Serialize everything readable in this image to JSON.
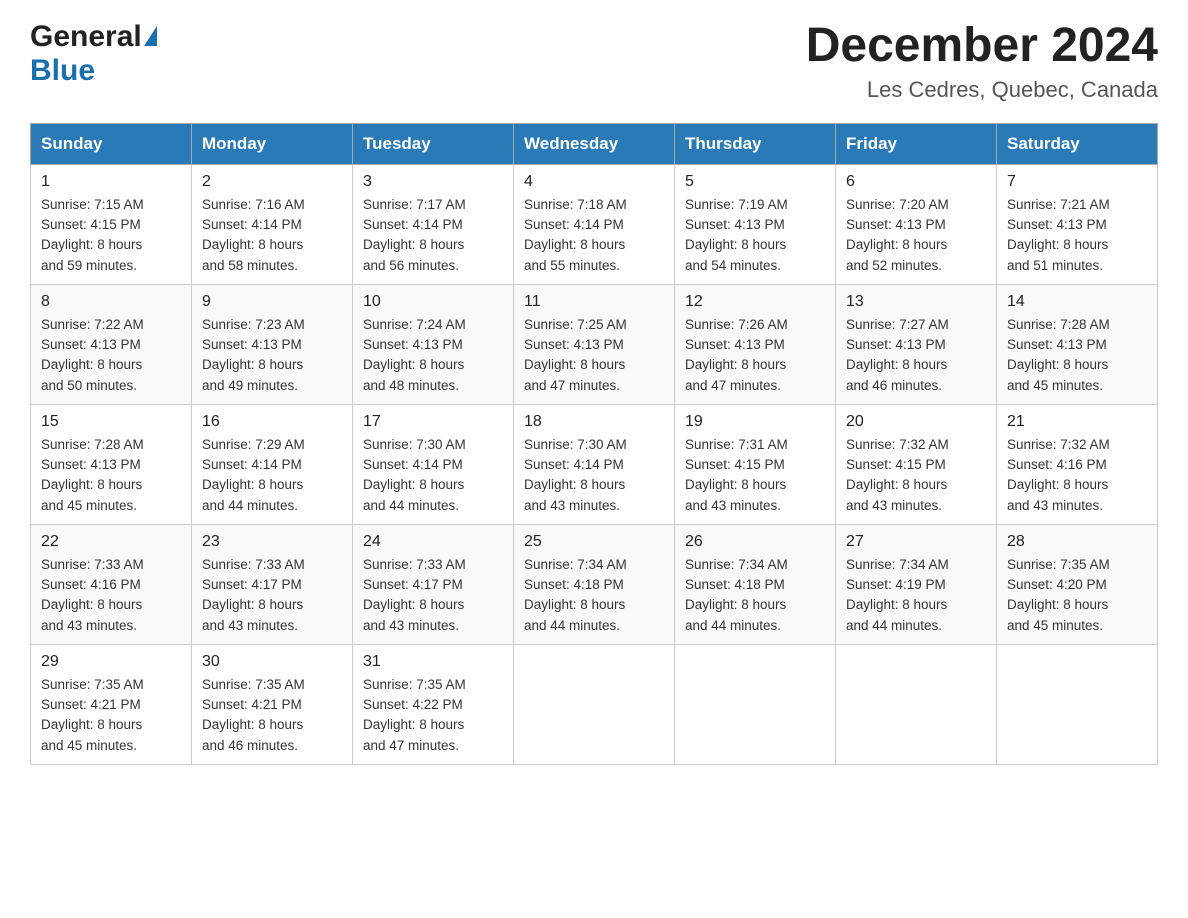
{
  "header": {
    "logo_general": "General",
    "logo_blue": "Blue",
    "month_year": "December 2024",
    "location": "Les Cedres, Quebec, Canada"
  },
  "weekdays": [
    "Sunday",
    "Monday",
    "Tuesday",
    "Wednesday",
    "Thursday",
    "Friday",
    "Saturday"
  ],
  "weeks": [
    [
      {
        "day": "1",
        "sunrise": "7:15 AM",
        "sunset": "4:15 PM",
        "daylight": "8 hours and 59 minutes."
      },
      {
        "day": "2",
        "sunrise": "7:16 AM",
        "sunset": "4:14 PM",
        "daylight": "8 hours and 58 minutes."
      },
      {
        "day": "3",
        "sunrise": "7:17 AM",
        "sunset": "4:14 PM",
        "daylight": "8 hours and 56 minutes."
      },
      {
        "day": "4",
        "sunrise": "7:18 AM",
        "sunset": "4:14 PM",
        "daylight": "8 hours and 55 minutes."
      },
      {
        "day": "5",
        "sunrise": "7:19 AM",
        "sunset": "4:13 PM",
        "daylight": "8 hours and 54 minutes."
      },
      {
        "day": "6",
        "sunrise": "7:20 AM",
        "sunset": "4:13 PM",
        "daylight": "8 hours and 52 minutes."
      },
      {
        "day": "7",
        "sunrise": "7:21 AM",
        "sunset": "4:13 PM",
        "daylight": "8 hours and 51 minutes."
      }
    ],
    [
      {
        "day": "8",
        "sunrise": "7:22 AM",
        "sunset": "4:13 PM",
        "daylight": "8 hours and 50 minutes."
      },
      {
        "day": "9",
        "sunrise": "7:23 AM",
        "sunset": "4:13 PM",
        "daylight": "8 hours and 49 minutes."
      },
      {
        "day": "10",
        "sunrise": "7:24 AM",
        "sunset": "4:13 PM",
        "daylight": "8 hours and 48 minutes."
      },
      {
        "day": "11",
        "sunrise": "7:25 AM",
        "sunset": "4:13 PM",
        "daylight": "8 hours and 47 minutes."
      },
      {
        "day": "12",
        "sunrise": "7:26 AM",
        "sunset": "4:13 PM",
        "daylight": "8 hours and 47 minutes."
      },
      {
        "day": "13",
        "sunrise": "7:27 AM",
        "sunset": "4:13 PM",
        "daylight": "8 hours and 46 minutes."
      },
      {
        "day": "14",
        "sunrise": "7:28 AM",
        "sunset": "4:13 PM",
        "daylight": "8 hours and 45 minutes."
      }
    ],
    [
      {
        "day": "15",
        "sunrise": "7:28 AM",
        "sunset": "4:13 PM",
        "daylight": "8 hours and 45 minutes."
      },
      {
        "day": "16",
        "sunrise": "7:29 AM",
        "sunset": "4:14 PM",
        "daylight": "8 hours and 44 minutes."
      },
      {
        "day": "17",
        "sunrise": "7:30 AM",
        "sunset": "4:14 PM",
        "daylight": "8 hours and 44 minutes."
      },
      {
        "day": "18",
        "sunrise": "7:30 AM",
        "sunset": "4:14 PM",
        "daylight": "8 hours and 43 minutes."
      },
      {
        "day": "19",
        "sunrise": "7:31 AM",
        "sunset": "4:15 PM",
        "daylight": "8 hours and 43 minutes."
      },
      {
        "day": "20",
        "sunrise": "7:32 AM",
        "sunset": "4:15 PM",
        "daylight": "8 hours and 43 minutes."
      },
      {
        "day": "21",
        "sunrise": "7:32 AM",
        "sunset": "4:16 PM",
        "daylight": "8 hours and 43 minutes."
      }
    ],
    [
      {
        "day": "22",
        "sunrise": "7:33 AM",
        "sunset": "4:16 PM",
        "daylight": "8 hours and 43 minutes."
      },
      {
        "day": "23",
        "sunrise": "7:33 AM",
        "sunset": "4:17 PM",
        "daylight": "8 hours and 43 minutes."
      },
      {
        "day": "24",
        "sunrise": "7:33 AM",
        "sunset": "4:17 PM",
        "daylight": "8 hours and 43 minutes."
      },
      {
        "day": "25",
        "sunrise": "7:34 AM",
        "sunset": "4:18 PM",
        "daylight": "8 hours and 44 minutes."
      },
      {
        "day": "26",
        "sunrise": "7:34 AM",
        "sunset": "4:18 PM",
        "daylight": "8 hours and 44 minutes."
      },
      {
        "day": "27",
        "sunrise": "7:34 AM",
        "sunset": "4:19 PM",
        "daylight": "8 hours and 44 minutes."
      },
      {
        "day": "28",
        "sunrise": "7:35 AM",
        "sunset": "4:20 PM",
        "daylight": "8 hours and 45 minutes."
      }
    ],
    [
      {
        "day": "29",
        "sunrise": "7:35 AM",
        "sunset": "4:21 PM",
        "daylight": "8 hours and 45 minutes."
      },
      {
        "day": "30",
        "sunrise": "7:35 AM",
        "sunset": "4:21 PM",
        "daylight": "8 hours and 46 minutes."
      },
      {
        "day": "31",
        "sunrise": "7:35 AM",
        "sunset": "4:22 PM",
        "daylight": "8 hours and 47 minutes."
      },
      null,
      null,
      null,
      null
    ]
  ],
  "labels": {
    "sunrise": "Sunrise:",
    "sunset": "Sunset:",
    "daylight": "Daylight:"
  }
}
